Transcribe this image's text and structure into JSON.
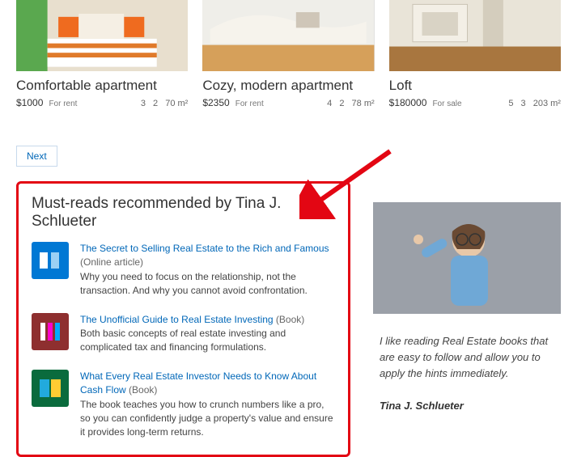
{
  "listings": [
    {
      "title": "Comfortable apartment",
      "price": "$1000",
      "terms": "For rent",
      "beds": "3",
      "baths": "2",
      "area": "70 m²"
    },
    {
      "title": "Cozy, modern apartment",
      "price": "$2350",
      "terms": "For rent",
      "beds": "4",
      "baths": "2",
      "area": "78 m²"
    },
    {
      "title": "Loft",
      "price": "$180000",
      "terms": "For sale",
      "beds": "5",
      "baths": "3",
      "area": "203 m²"
    }
  ],
  "next_button": "Next",
  "recs": {
    "heading": "Must-reads recommended by Tina J. Schlueter",
    "items": [
      {
        "link": "The Secret to Selling Real Estate to the Rich and Famous",
        "kind": "(Online article)",
        "desc": "Why you need to focus on the relationship, not the transaction. And why you cannot avoid confrontation."
      },
      {
        "link": "The Unofficial Guide to Real Estate Investing",
        "kind": "(Book)",
        "desc": "Both basic concepts of real estate investing and complicated tax and financing formulations."
      },
      {
        "link": "What Every Real Estate Investor Needs to Know About Cash Flow",
        "kind": "(Book)",
        "desc": "The book teaches you how to crunch numbers like a pro, so you can confidently judge a property's value and ensure it provides long-term returns."
      }
    ]
  },
  "quote": "I like reading Real Estate books that are easy to follow and allow you to apply the hints immediately.",
  "author": "Tina J. Schlueter"
}
